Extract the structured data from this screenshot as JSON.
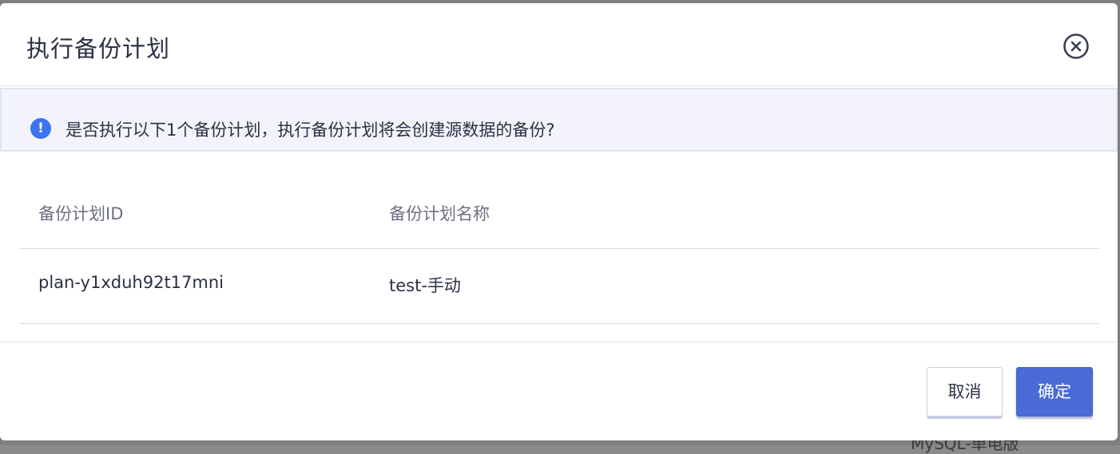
{
  "modal": {
    "title": "执行备份计划",
    "close_icon": "close-circle-icon"
  },
  "alert": {
    "icon": "info-exclamation-icon",
    "message": "是否执行以下1个备份计划，执行备份计划将会创建源数据的备份?"
  },
  "table": {
    "columns": [
      "备份计划ID",
      "备份计划名称"
    ],
    "rows": [
      [
        "plan-y1xduh92t17mni",
        "test-手动"
      ]
    ]
  },
  "footer": {
    "cancel_label": "取消",
    "confirm_label": "确定"
  },
  "background": {
    "partial_text": "MySQL-单电版"
  },
  "colors": {
    "primary": "#4a6bd6",
    "alert_icon": "#3b73f0",
    "alert_bg": "#f3f4fb"
  }
}
